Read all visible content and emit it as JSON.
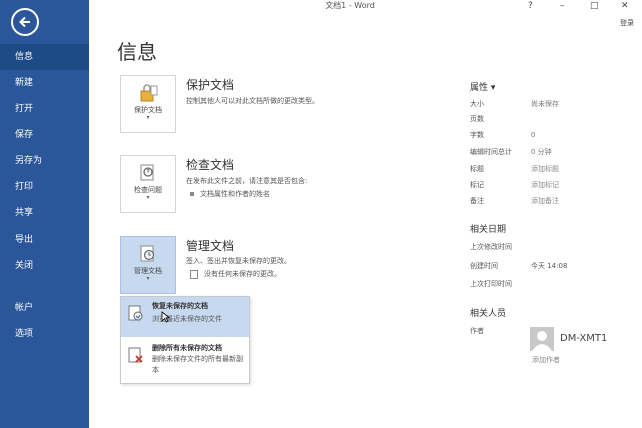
{
  "colors": {
    "brand": "#2b579a",
    "active": "#1e4a86",
    "selected": "#c7d9ee"
  },
  "window": {
    "title": "文档1 - Word",
    "help": "?",
    "minimize": "–",
    "maximize": "□",
    "close": "✕",
    "login": "登录"
  },
  "sidebar": {
    "items": [
      {
        "label": "信息",
        "active": true
      },
      {
        "label": "新建"
      },
      {
        "label": "打开"
      },
      {
        "label": "保存"
      },
      {
        "label": "另存为"
      },
      {
        "label": "打印"
      },
      {
        "label": "共享"
      },
      {
        "label": "导出"
      },
      {
        "label": "关闭"
      },
      {
        "label": "帐户"
      },
      {
        "label": "选项"
      }
    ]
  },
  "main": {
    "title": "信息",
    "protect": {
      "card_label": "保护文档",
      "title": "保护文档",
      "desc": "控制其他人可以对此文档所做的更改类型。"
    },
    "inspect": {
      "card_label": "检查问题",
      "title": "检查文档",
      "desc": "在发布此文件之前，请注意其是否包含:",
      "bullet": "文档属性和作者的姓名"
    },
    "manage": {
      "card_label": "管理文档",
      "title": "管理文档",
      "desc": "签入、签出并恢复未保存的更改。",
      "bullet": "没有任何未保存的更改。"
    },
    "dropdown": [
      {
        "title": "恢复未保存的文档",
        "desc": "浏览最近未保存的文件"
      },
      {
        "title": "删除所有未保存的文档",
        "desc": "删除未保存文件的所有最新副本"
      }
    ]
  },
  "properties": {
    "heading": "属性 ▾",
    "rows": [
      {
        "k": "大小",
        "v": "尚未保存"
      },
      {
        "k": "页数",
        "v": ""
      },
      {
        "k": "字数",
        "v": "0"
      },
      {
        "k": "编辑时间总计",
        "v": "0 分钟"
      },
      {
        "k": "标题",
        "v": "添加标题"
      },
      {
        "k": "标记",
        "v": "添加标记"
      },
      {
        "k": "备注",
        "v": "添加备注"
      }
    ],
    "dates_heading": "相关日期",
    "dates": [
      {
        "k": "上次修改时间",
        "v": ""
      },
      {
        "k": "创建时间",
        "v": "今天 14:08"
      },
      {
        "k": "上次打印时间",
        "v": ""
      }
    ],
    "people_heading": "相关人员",
    "author_label": "作者",
    "author_name": "DM-XMT1",
    "add_author": "添加作者"
  }
}
